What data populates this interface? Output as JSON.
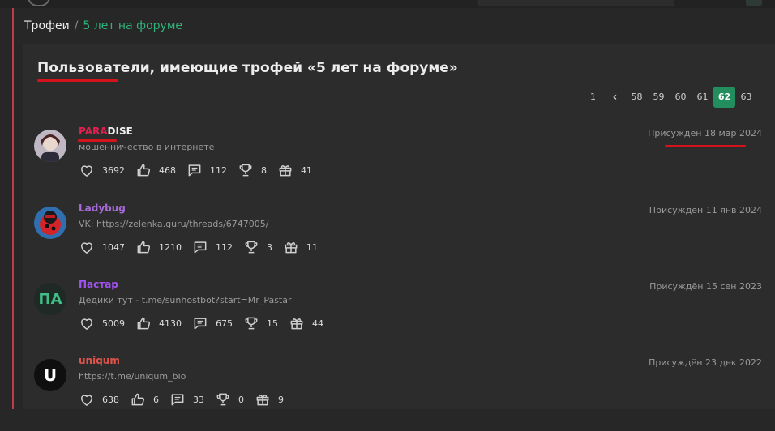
{
  "breadcrumb": {
    "root": "Трофеи",
    "separator": "/",
    "current": "5 лет на форуме"
  },
  "page_title": "Пользователи, имеющие трофей «5 лет на форуме»",
  "pagination": {
    "pages": [
      "1",
      "58",
      "59",
      "60",
      "61",
      "62",
      "63"
    ],
    "prev_icon": "chevron-left-icon",
    "current": "62"
  },
  "users": [
    {
      "name_part1": "PARA",
      "name_part2": "DISE",
      "name_color1": "#e1204f",
      "name_color2": "#f0f0f0",
      "status": "мошенничество в интернете",
      "date": "Присуждён 18 мар 2024",
      "likes": "3692",
      "sympathies": "468",
      "messages": "112",
      "trophies": "8",
      "gifts": "41",
      "avatar": "anime-character-avatar"
    },
    {
      "name_part1": "Ladybug",
      "name_part2": "",
      "name_color1": "#a86ad9",
      "name_color2": "#a86ad9",
      "status": "VK: https://zelenka.guru/threads/6747005/",
      "date": "Присуждён 11 янв 2024",
      "likes": "1047",
      "sympathies": "1210",
      "messages": "112",
      "trophies": "3",
      "gifts": "11",
      "avatar": "ladybug-avatar"
    },
    {
      "name_part1": "Пастар",
      "name_part2": "",
      "name_color1": "#a152f2",
      "name_color2": "#a152f2",
      "status": "Дедики тут - t.me/sunhostbot?start=Mr_Pastar",
      "date": "Присуждён 15 сен 2023",
      "likes": "5009",
      "sympathies": "4130",
      "messages": "675",
      "trophies": "15",
      "gifts": "44",
      "avatar_text": "ПА",
      "avatar_color": "#1f2a27",
      "avatar_text_color": "#3fbf86"
    },
    {
      "name_part1": "uniqum",
      "name_part2": "",
      "name_color1": "#e0534a",
      "name_color2": "#e0534a",
      "status": "https://t.me/uniqum_bio",
      "date": "Присуждён 23 дек 2022",
      "likes": "638",
      "sympathies": "6",
      "messages": "33",
      "trophies": "0",
      "gifts": "9",
      "avatar_text": "U",
      "avatar_color": "#0f0f0f",
      "avatar_text_color": "#ffffff"
    }
  ]
}
